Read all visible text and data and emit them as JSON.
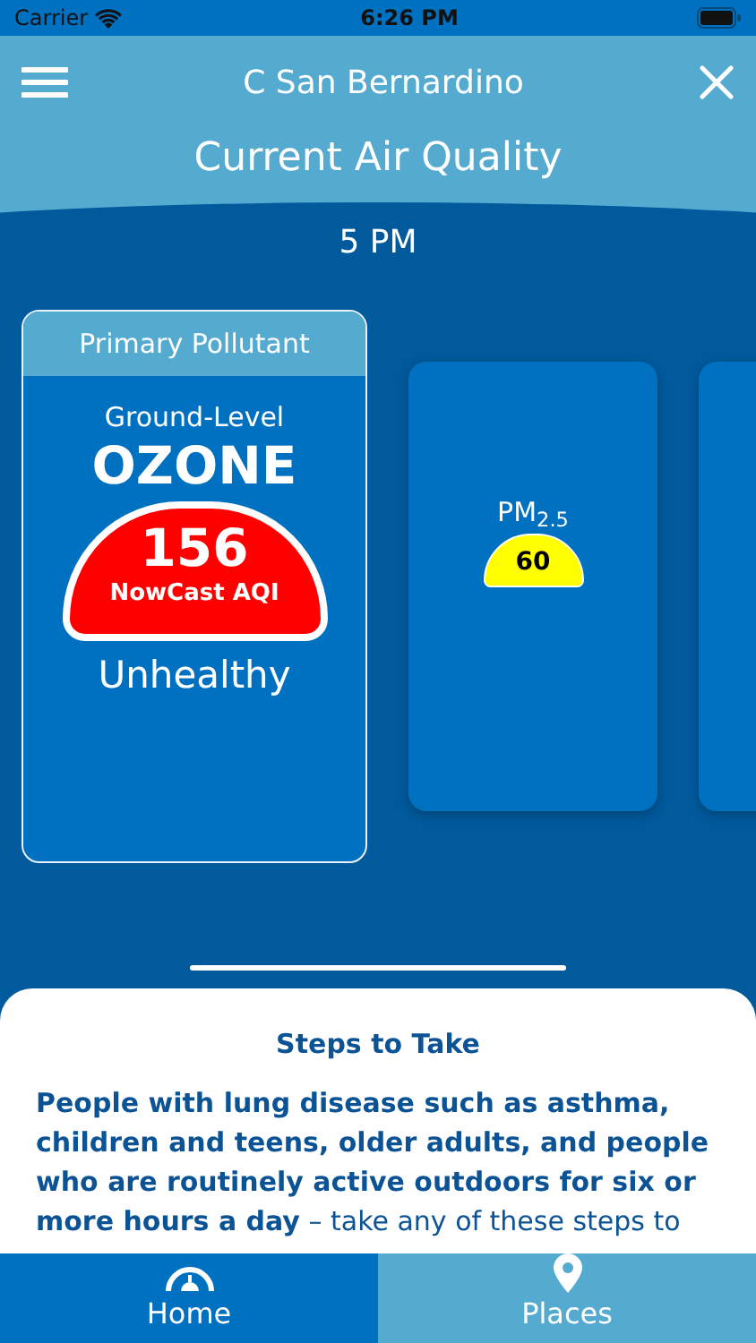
{
  "status_bar": {
    "carrier": "Carrier",
    "time": "6:26 PM"
  },
  "header": {
    "location": "C San Bernardino",
    "title": "Current Air Quality",
    "hour": "5 PM"
  },
  "cards": [
    {
      "kind": "primary",
      "heading": "Primary Pollutant",
      "qualifier": "Ground-Level",
      "name": "OZONE",
      "value": "156",
      "value_label": "NowCast AQI",
      "category": "Unhealthy",
      "color": "#ff0000"
    },
    {
      "kind": "secondary",
      "name": "PM$_{2.5}$",
      "value": "60",
      "color": "#ffff00"
    },
    {
      "kind": "secondary"
    }
  ],
  "steps": {
    "title": "Steps to Take",
    "text": "**People with lung disease such as asthma, children and teens, older adults, and people who are routinely active outdoors for six or more hours a day** – take any of these steps to"
  },
  "tabs": [
    {
      "label": "Home",
      "selected": true
    },
    {
      "label": "Places",
      "selected": false
    }
  ]
}
